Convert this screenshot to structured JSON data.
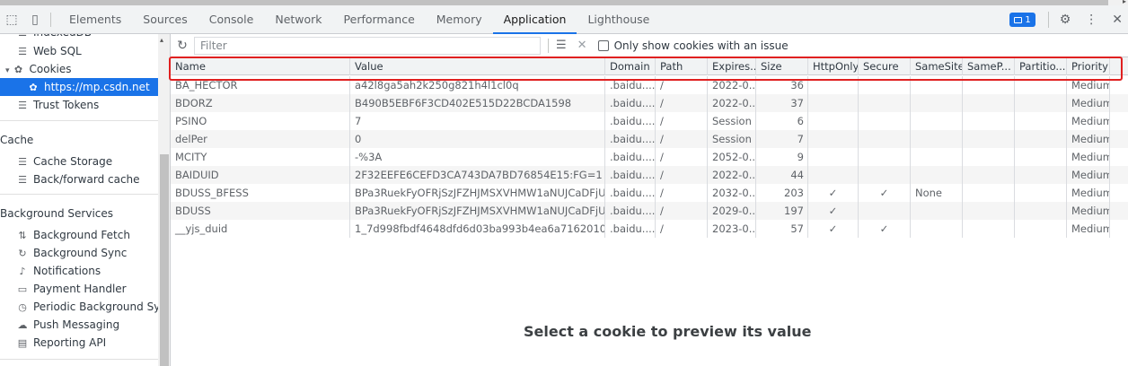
{
  "tabs": [
    "Elements",
    "Sources",
    "Console",
    "Network",
    "Performance",
    "Memory",
    "Application",
    "Lighthouse"
  ],
  "active_tab": "Application",
  "issues_badge": "1",
  "sidebar": {
    "items_top": [
      {
        "label": "IndexedDB",
        "icon": "database-icon"
      },
      {
        "label": "Web SQL",
        "icon": "database-icon"
      },
      {
        "label": "Cookies",
        "icon": "cookie-icon"
      },
      {
        "label": "https://mp.csdn.net",
        "icon": "cookie-icon"
      },
      {
        "label": "Trust Tokens",
        "icon": "database-icon"
      }
    ],
    "cache_section": "Cache",
    "cache_items": [
      {
        "label": "Cache Storage",
        "icon": "database-icon"
      },
      {
        "label": "Back/forward cache",
        "icon": "database-icon"
      }
    ],
    "bg_section": "Background Services",
    "bg_items": [
      {
        "label": "Background Fetch",
        "icon": "arrows-updown-icon"
      },
      {
        "label": "Background Sync",
        "icon": "sync-icon"
      },
      {
        "label": "Notifications",
        "icon": "bell-icon"
      },
      {
        "label": "Payment Handler",
        "icon": "card-icon"
      },
      {
        "label": "Periodic Background Sync",
        "icon": "clock-icon"
      },
      {
        "label": "Push Messaging",
        "icon": "cloud-icon"
      },
      {
        "label": "Reporting API",
        "icon": "document-icon"
      }
    ]
  },
  "toolbar": {
    "filter_placeholder": "Filter",
    "issue_checkbox_label": "Only show cookies with an issue"
  },
  "table": {
    "columns": [
      "Name",
      "Value",
      "Domain",
      "Path",
      "Expires...",
      "Size",
      "HttpOnly",
      "Secure",
      "SameSite",
      "SameP...",
      "Partitio...",
      "Priority"
    ],
    "rows": [
      [
        "BA_HECTOR",
        "a42l8ga5ah2k250g821h4l1cl0q",
        ".baidu....",
        "/",
        "2022-0...",
        "36",
        "",
        "",
        "",
        "",
        "",
        "Medium"
      ],
      [
        "BDORZ",
        "B490B5EBF6F3CD402E515D22BCDA1598",
        ".baidu....",
        "/",
        "2022-0...",
        "37",
        "",
        "",
        "",
        "",
        "",
        "Medium"
      ],
      [
        "PSINO",
        "7",
        ".baidu....",
        "/",
        "Session",
        "6",
        "",
        "",
        "",
        "",
        "",
        "Medium"
      ],
      [
        "delPer",
        "0",
        ".baidu....",
        "/",
        "Session",
        "7",
        "",
        "",
        "",
        "",
        "",
        "Medium"
      ],
      [
        "MCITY",
        "-%3A",
        ".baidu....",
        "/",
        "2052-0...",
        "9",
        "",
        "",
        "",
        "",
        "",
        "Medium"
      ],
      [
        "BAIDUID",
        "2F32EEFE6CEFD3CA743DA7BD76854E15:FG=1",
        ".baidu....",
        "/",
        "2022-0...",
        "44",
        "",
        "",
        "",
        "",
        "",
        "Medium"
      ],
      [
        "BDUSS_BFESS",
        "BPa3RuekFyOFRjSzJFZHJMSXVHMW1aNUJCaDFjU...",
        ".baidu....",
        "/",
        "2032-0...",
        "203",
        "✓",
        "✓",
        "None",
        "",
        "",
        "Medium"
      ],
      [
        "BDUSS",
        "BPa3RuekFyOFRjSzJFZHJMSXVHMW1aNUJCaDFjU...",
        ".baidu....",
        "/",
        "2029-0...",
        "197",
        "✓",
        "",
        "",
        "",
        "",
        "Medium"
      ],
      [
        "__yjs_duid",
        "1_7d998fbdf4648dfd6d03ba993b4ea6a716201067...",
        ".baidu....",
        "/",
        "2023-0...",
        "57",
        "✓",
        "✓",
        "",
        "",
        "",
        "Medium"
      ]
    ]
  },
  "preview_message": "Select a cookie to preview its value"
}
